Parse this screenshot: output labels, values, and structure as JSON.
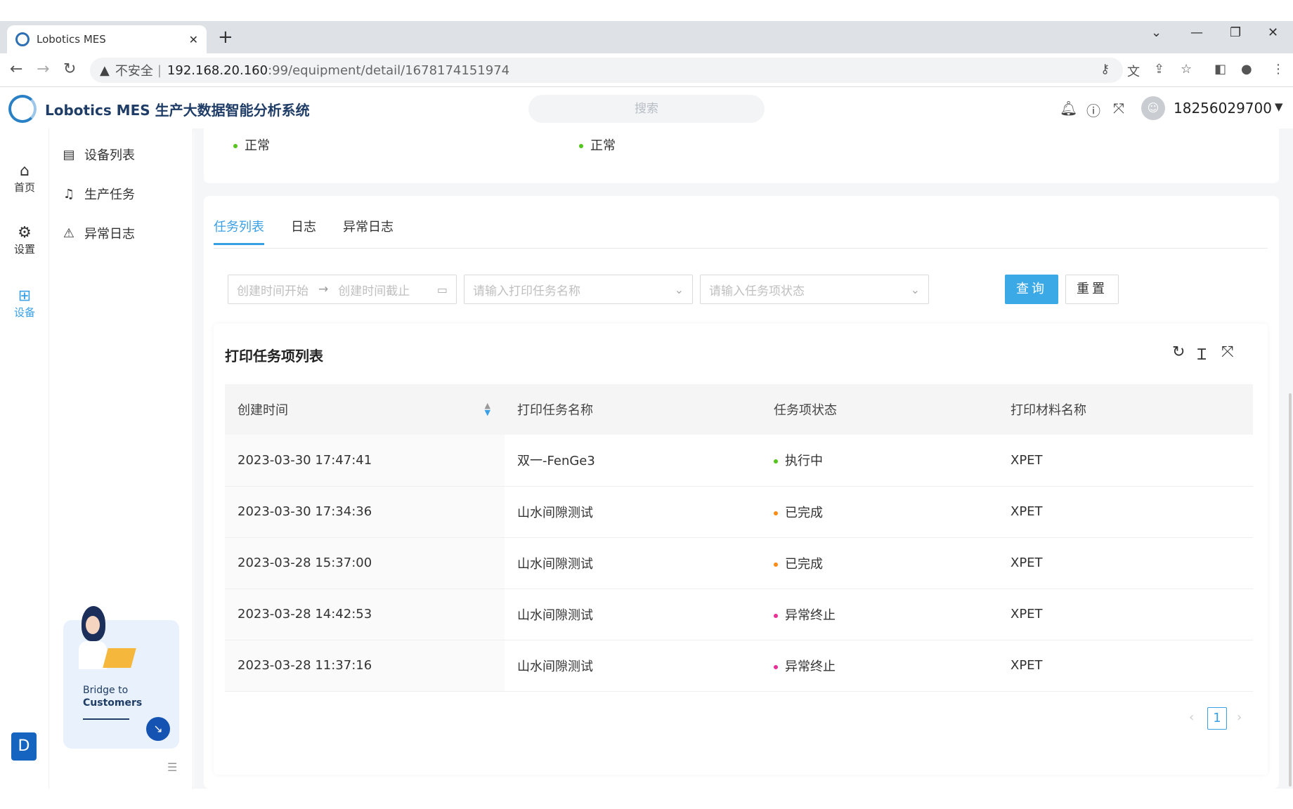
{
  "browser": {
    "tab_title": "Lobotics MES",
    "tab_close": "✕",
    "new_tab": "+",
    "insecure_label": "不安全",
    "url_host": "192.168.20.160",
    "url_path": ":99/equipment/detail/1678174151974",
    "win_min": "—",
    "win_max": "❐",
    "win_close": "✕",
    "win_dropdown": "⌄"
  },
  "header": {
    "app_name": "Lobotics MES 生产大数据智能分析系统",
    "search_placeholder": "搜索",
    "username": "18256029700"
  },
  "rail": {
    "items": [
      {
        "label": "首页",
        "icon": "home-icon"
      },
      {
        "label": "设置",
        "icon": "gear-icon"
      },
      {
        "label": "设备",
        "icon": "grid-icon"
      }
    ],
    "app_badge": "D"
  },
  "submenu": {
    "items": [
      {
        "label": "设备列表",
        "icon": "list-icon"
      },
      {
        "label": "生产任务",
        "icon": "bell-icon"
      },
      {
        "label": "异常日志",
        "icon": "warning-icon"
      }
    ],
    "promo_line1": "Bridge to",
    "promo_line2": "Customers"
  },
  "status": {
    "left": "正常",
    "right": "正常",
    "color": "#52c41a"
  },
  "tabs": [
    {
      "label": "任务列表",
      "active": true
    },
    {
      "label": "日志",
      "active": false
    },
    {
      "label": "异常日志",
      "active": false
    }
  ],
  "filters": {
    "start_placeholder": "创建时间开始",
    "end_placeholder": "创建时间截止",
    "task_name_placeholder": "请输入打印任务名称",
    "task_status_placeholder": "请输入任务项状态",
    "query_label": "查询",
    "reset_label": "重置"
  },
  "table": {
    "title": "打印任务项列表",
    "columns": [
      "创建时间",
      "打印任务名称",
      "任务项状态",
      "打印材料名称"
    ],
    "rows": [
      {
        "time": "2023-03-30 17:47:41",
        "name": "双一-FenGe3",
        "status": "执行中",
        "status_color": "#52c41a",
        "material": "XPET"
      },
      {
        "time": "2023-03-30 17:34:36",
        "name": "山水间隙测试",
        "status": "已完成",
        "status_color": "#fa8c16",
        "material": "XPET"
      },
      {
        "time": "2023-03-28 15:37:00",
        "name": "山水间隙测试",
        "status": "已完成",
        "status_color": "#fa8c16",
        "material": "XPET"
      },
      {
        "time": "2023-03-28 14:42:53",
        "name": "山水间隙测试",
        "status": "异常终止",
        "status_color": "#eb2f96",
        "material": "XPET"
      },
      {
        "time": "2023-03-28 11:37:16",
        "name": "山水间隙测试",
        "status": "异常终止",
        "status_color": "#eb2f96",
        "material": "XPET"
      }
    ]
  },
  "pagination": {
    "current_page": "1",
    "prev": "‹",
    "next": "›"
  },
  "colors": {
    "accent": "#3aa0e6",
    "brand": "#1f3d66"
  }
}
